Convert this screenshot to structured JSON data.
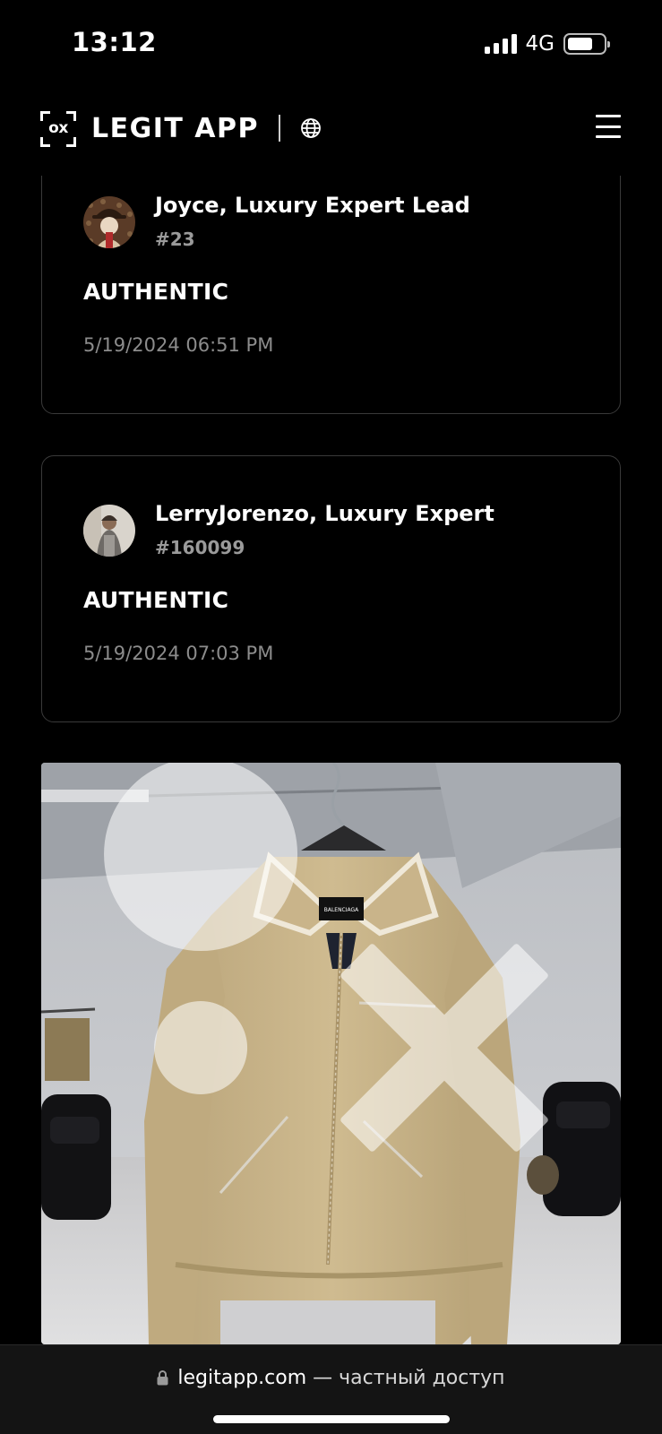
{
  "status_bar": {
    "time": "13:12",
    "network": "4G",
    "battery_level": 0.7,
    "signal_bars": 4
  },
  "header": {
    "logo_text": "ox",
    "brand": "LEGIT APP",
    "globe_icon": "globe-icon",
    "menu_icon": "hamburger-menu-icon"
  },
  "checks": [
    {
      "expert": "Joyce, Luxury Expert Lead",
      "id": "#23",
      "verdict": "AUTHENTIC",
      "timestamp": "5/19/2024 06:51 PM"
    },
    {
      "expert": "LerryJorenzo, Luxury Expert",
      "id": "#160099",
      "verdict": "AUTHENTIC",
      "timestamp": "5/19/2024 07:03 PM"
    }
  ],
  "photo": {
    "watermark": "ox",
    "label_text": "BALENCIAGA"
  },
  "browser_bar": {
    "domain": "legitapp.com",
    "suffix": " — частный доступ"
  },
  "colors": {
    "background": "#000000",
    "card_border": "#3a3a3a",
    "muted_text": "#8c8c8c",
    "jacket": "#c9b48a"
  }
}
